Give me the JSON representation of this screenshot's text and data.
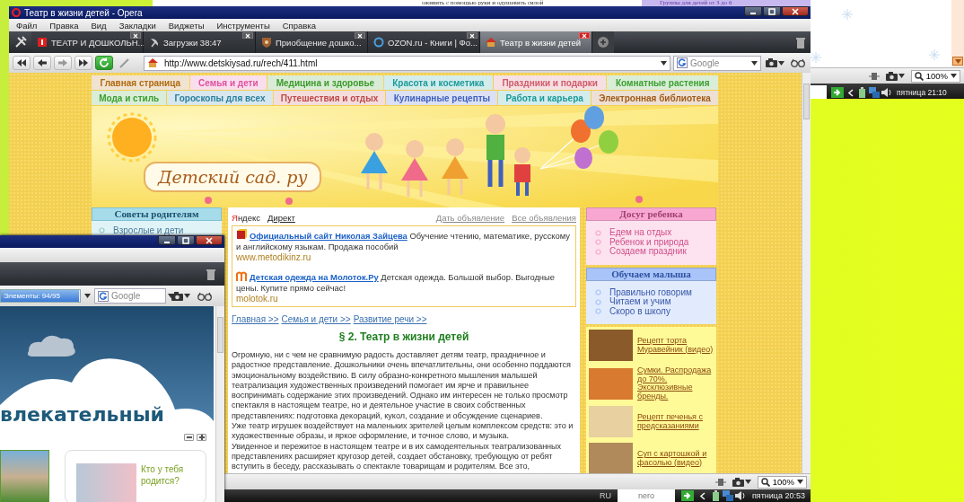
{
  "back_window": {
    "texts": [
      "оживить с помощью руки и одушевить силой",
      "Группы для детей от 3 до 6"
    ]
  },
  "main_window": {
    "title": "Театр в жизни детей - Opera",
    "menu": [
      "Файл",
      "Правка",
      "Вид",
      "Закладки",
      "Виджеты",
      "Инструменты",
      "Справка"
    ],
    "tabs": [
      {
        "label": "ТЕАТР И ДОШКОЛЬН...",
        "kind": "yandex",
        "selected": false
      },
      {
        "label": "Загрузки 38:47",
        "kind": "download",
        "selected": false
      },
      {
        "label": "Приобщение дошко...",
        "kind": "shield",
        "selected": false
      },
      {
        "label": "OZON.ru - Книги | Фо...",
        "kind": "ring",
        "selected": false
      },
      {
        "label": "Театр в жизни детей",
        "kind": "house",
        "selected": true
      }
    ],
    "address": "http://www.detskiysad.ru/rech/411.html",
    "search_placeholder": "Google",
    "page": {
      "nav_rows": [
        [
          {
            "label": "Главная страница",
            "color": "#b06a10"
          },
          {
            "label": "Семья и дети",
            "color": "#e050a0"
          },
          {
            "label": "Медицина и здоровье",
            "color": "#3a9a2a"
          },
          {
            "label": "Красота и косметика",
            "color": "#1a9a9a"
          },
          {
            "label": "Праздники и подарки",
            "color": "#d05a6a"
          },
          {
            "label": "Комнатные растения",
            "color": "#3aa030"
          }
        ],
        [
          {
            "label": "Мода и стиль",
            "color": "#3aa030"
          },
          {
            "label": "Гороскопы для всех",
            "color": "#2a80a0"
          },
          {
            "label": "Путешествия и отдых",
            "color": "#c04848"
          },
          {
            "label": "Кулинарные рецепты",
            "color": "#4060c0"
          },
          {
            "label": "Работа и карьера",
            "color": "#1a9a9a"
          },
          {
            "label": "Электронная библиотека",
            "color": "#a05a18"
          }
        ]
      ],
      "logo": "Детский сад. ру",
      "left_panel": {
        "title": "Советы родителям",
        "items": [
          "Взрослые и дети"
        ]
      },
      "ads": {
        "brand": "Яндекс",
        "direct": "Директ",
        "links": [
          "Дать объявление",
          "Все объявления"
        ],
        "items": [
          {
            "kind": "book",
            "title": "Официальный сайт Николая Зайцева",
            "text": "Обучение чтению, математике, русскому и английскому языкам. Продажа пособий",
            "url": "www.metodikinz.ru"
          },
          {
            "kind": "arch",
            "title": "Детская одежда на Молоток.Ру",
            "text": "Детская одежда. Большой выбор. Выгодные цены. Купите прямо сейчас!",
            "url": "molotok.ru"
          }
        ]
      },
      "breadcrumb": [
        "Главная >>",
        "Семья и дети >>",
        "Развитие речи >>"
      ],
      "heading": "§ 2. Театр в жизни детей",
      "paragraphs": [
        "Огромную, ни с чем не сравнимую радость доставляет детям театр, праздничное и радостное представление. Дошкольники очень впечатлительны, они особенно поддаются эмоциональному воздействию. В силу образно-конкретного мышления малышей театрализация художественных произведений помогает им ярче и правильнее воспринимать содержание этих произведений. Однако им интересен не только просмотр спектакля в настоящем театре, но и деятельное участие в своих собственных представлениях: подготовка декораций, кукол, создание и обсуждение сценариев.",
        "Уже театр игрушек воздействует на маленьких зрителей целым комплексом средств: это и художественные образы, и яркое оформление, и точное слово, и музыка.",
        "Увиденное и пережитое в настоящем театре и в их самодеятельных театрализованных представлениях расширяет кругозор детей, создает обстановку, требующую от ребят вступить в беседу, рассказывать о спектакле товарищам и родителям. Все это,"
      ],
      "right_panels": [
        {
          "title": "Досуг ребенка",
          "color": "#f8a8d0",
          "items": [
            "Едем на отдых",
            "Ребенок и природа",
            "Создаем праздник"
          ]
        },
        {
          "title": "Обучаем малыша",
          "color": "#a8c4f8",
          "items": [
            "Правильно говорим",
            "Читаем и учим",
            "Скоро в школу"
          ]
        }
      ],
      "promos": [
        {
          "kind": "cake",
          "text": "Рецепт торта Муравейник (видео)"
        },
        {
          "kind": "bag",
          "text": "Сумки. Распродажа до 70%. Эксклюзивные бренды."
        },
        {
          "kind": "cookie",
          "text": "Рецепт печенья с предсказаниями"
        },
        {
          "kind": "soup",
          "text": "Суп с картошкой и фасолью (видео)"
        }
      ]
    },
    "status": {
      "zoom": "100%"
    },
    "taskbar": {
      "language": "RU",
      "app": "nero",
      "clock": "пятница 20:53"
    }
  },
  "left_window": {
    "progress": {
      "label": "Элементы: 94/95",
      "level": 0.99
    },
    "search_placeholder": "Google",
    "heading": "влекательный",
    "card_text": "Кто у тебя родится?"
  },
  "right_window": {
    "zoom": "100%",
    "clock": "пятница 21:10"
  }
}
